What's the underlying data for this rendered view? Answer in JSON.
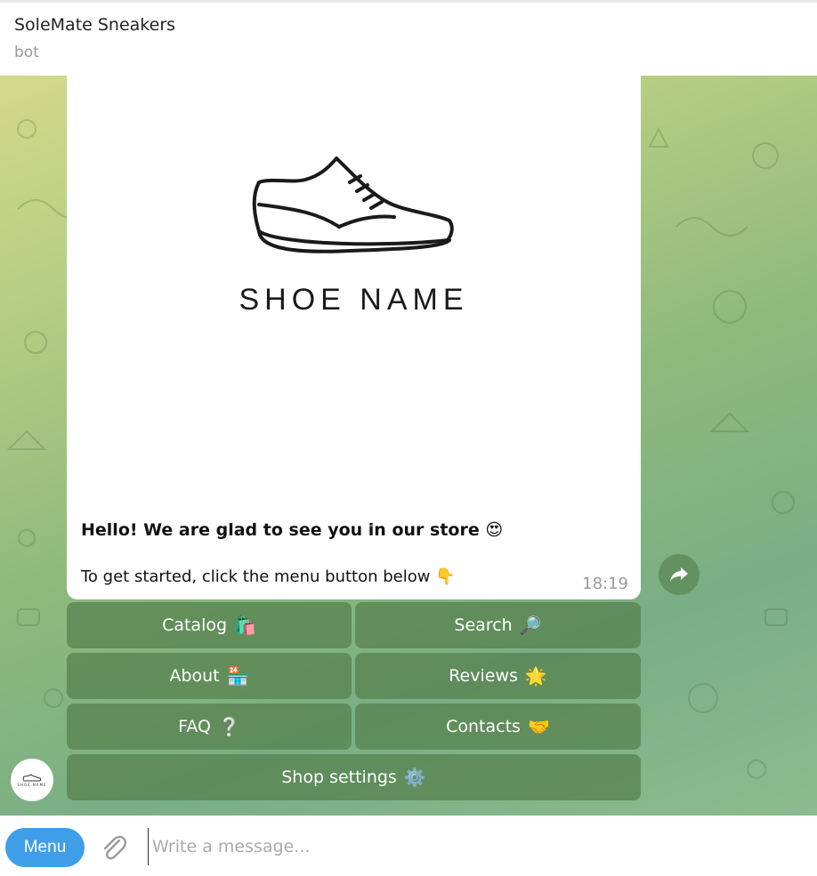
{
  "header": {
    "title": "SoleMate Sneakers",
    "subtitle": "bot"
  },
  "message": {
    "logo_text": "SHOE NAME",
    "greeting": "Hello! We are glad to see you in our store 😍",
    "instruction": "To get started, click the menu button below 👇",
    "time": "18:19"
  },
  "keyboard": {
    "catalog": {
      "label": "Catalog",
      "emoji": "🛍️"
    },
    "search": {
      "label": "Search",
      "emoji": "🔎"
    },
    "about": {
      "label": "About",
      "emoji": "🏪"
    },
    "reviews": {
      "label": "Reviews",
      "emoji": "🌟"
    },
    "faq": {
      "label": "FAQ",
      "emoji": "❔"
    },
    "contacts": {
      "label": "Contacts",
      "emoji": "🤝"
    },
    "shop_settings": {
      "label": "Shop settings",
      "emoji": "⚙️"
    }
  },
  "avatar": {
    "text": "SHOE NAME"
  },
  "composer": {
    "menu_label": "Menu",
    "placeholder": "Write a message..."
  },
  "colors": {
    "accent": "#3e9ee8",
    "keyboard_button": "#54804c"
  }
}
